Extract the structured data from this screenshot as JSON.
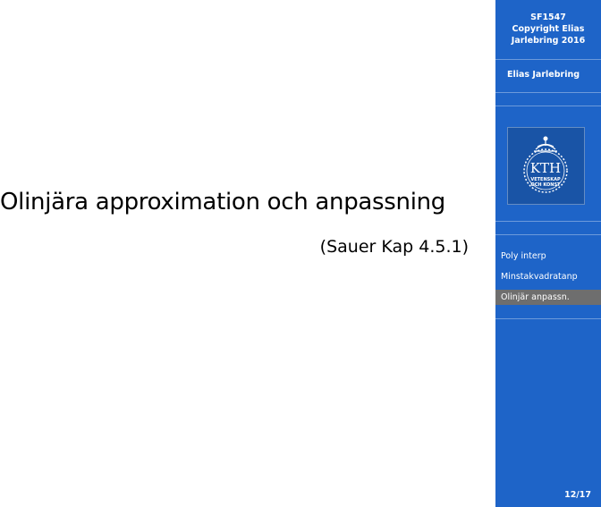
{
  "slide": {
    "title": "Olinjära approximation och anpassning",
    "subtitle": "(Sauer Kap 4.5.1)"
  },
  "sidebar": {
    "course_line1": "SF1547",
    "course_line2": "Copyright Elias",
    "course_line3": "Jarlebring 2016",
    "author": "Elias Jarlebring",
    "logo": {
      "icon": "kth-logo-icon",
      "text": "KTH",
      "subtext_line1": "VETENSKAP",
      "subtext_line2": "OCH KONST"
    },
    "nav": [
      {
        "label": "Poly interp"
      },
      {
        "label": "Minstakvadratanp"
      },
      {
        "label": "Olinjär anpassn."
      }
    ],
    "active_index": 2,
    "page_number": "12/17"
  },
  "colors": {
    "sidebar_bg": "#1e64c8",
    "active_item_bg": "#6e6e6e",
    "text_on_sidebar": "#ffffff"
  }
}
